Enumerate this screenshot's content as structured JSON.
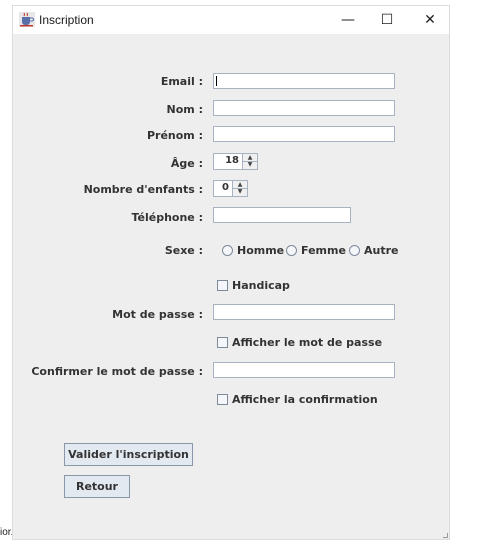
{
  "window": {
    "title": "Inscription",
    "minimize_glyph": "—",
    "maximize_glyph": "☐",
    "close_glyph": "✕",
    "icon": "java-cup-icon"
  },
  "form": {
    "email_label": "Email :",
    "email_value": "",
    "nom_label": "Nom :",
    "nom_value": "",
    "prenom_label": "Prénom :",
    "prenom_value": "",
    "age_label": "Âge :",
    "age_value": "18",
    "enfants_label": "Nombre d'enfants :",
    "enfants_value": "0",
    "telephone_label": "Téléphone :",
    "telephone_value": "",
    "sexe_label": "Sexe :",
    "sexe_options": [
      "Homme",
      "Femme",
      "Autre"
    ],
    "handicap_label": "Handicap",
    "password_label": "Mot de passe :",
    "password_value": "",
    "show_password_label": "Afficher le mot de passe",
    "confirm_label": "Confirmer le mot de passe :",
    "confirm_value": "",
    "show_confirm_label": "Afficher la confirmation"
  },
  "buttons": {
    "submit": "Valider l'inscription",
    "back": "Retour"
  },
  "background": {
    "stray_text": "ior."
  },
  "colors": {
    "window_bg": "#eeeeee",
    "field_border": "#a8b3c2",
    "button_bg": "#e3e9f1"
  }
}
